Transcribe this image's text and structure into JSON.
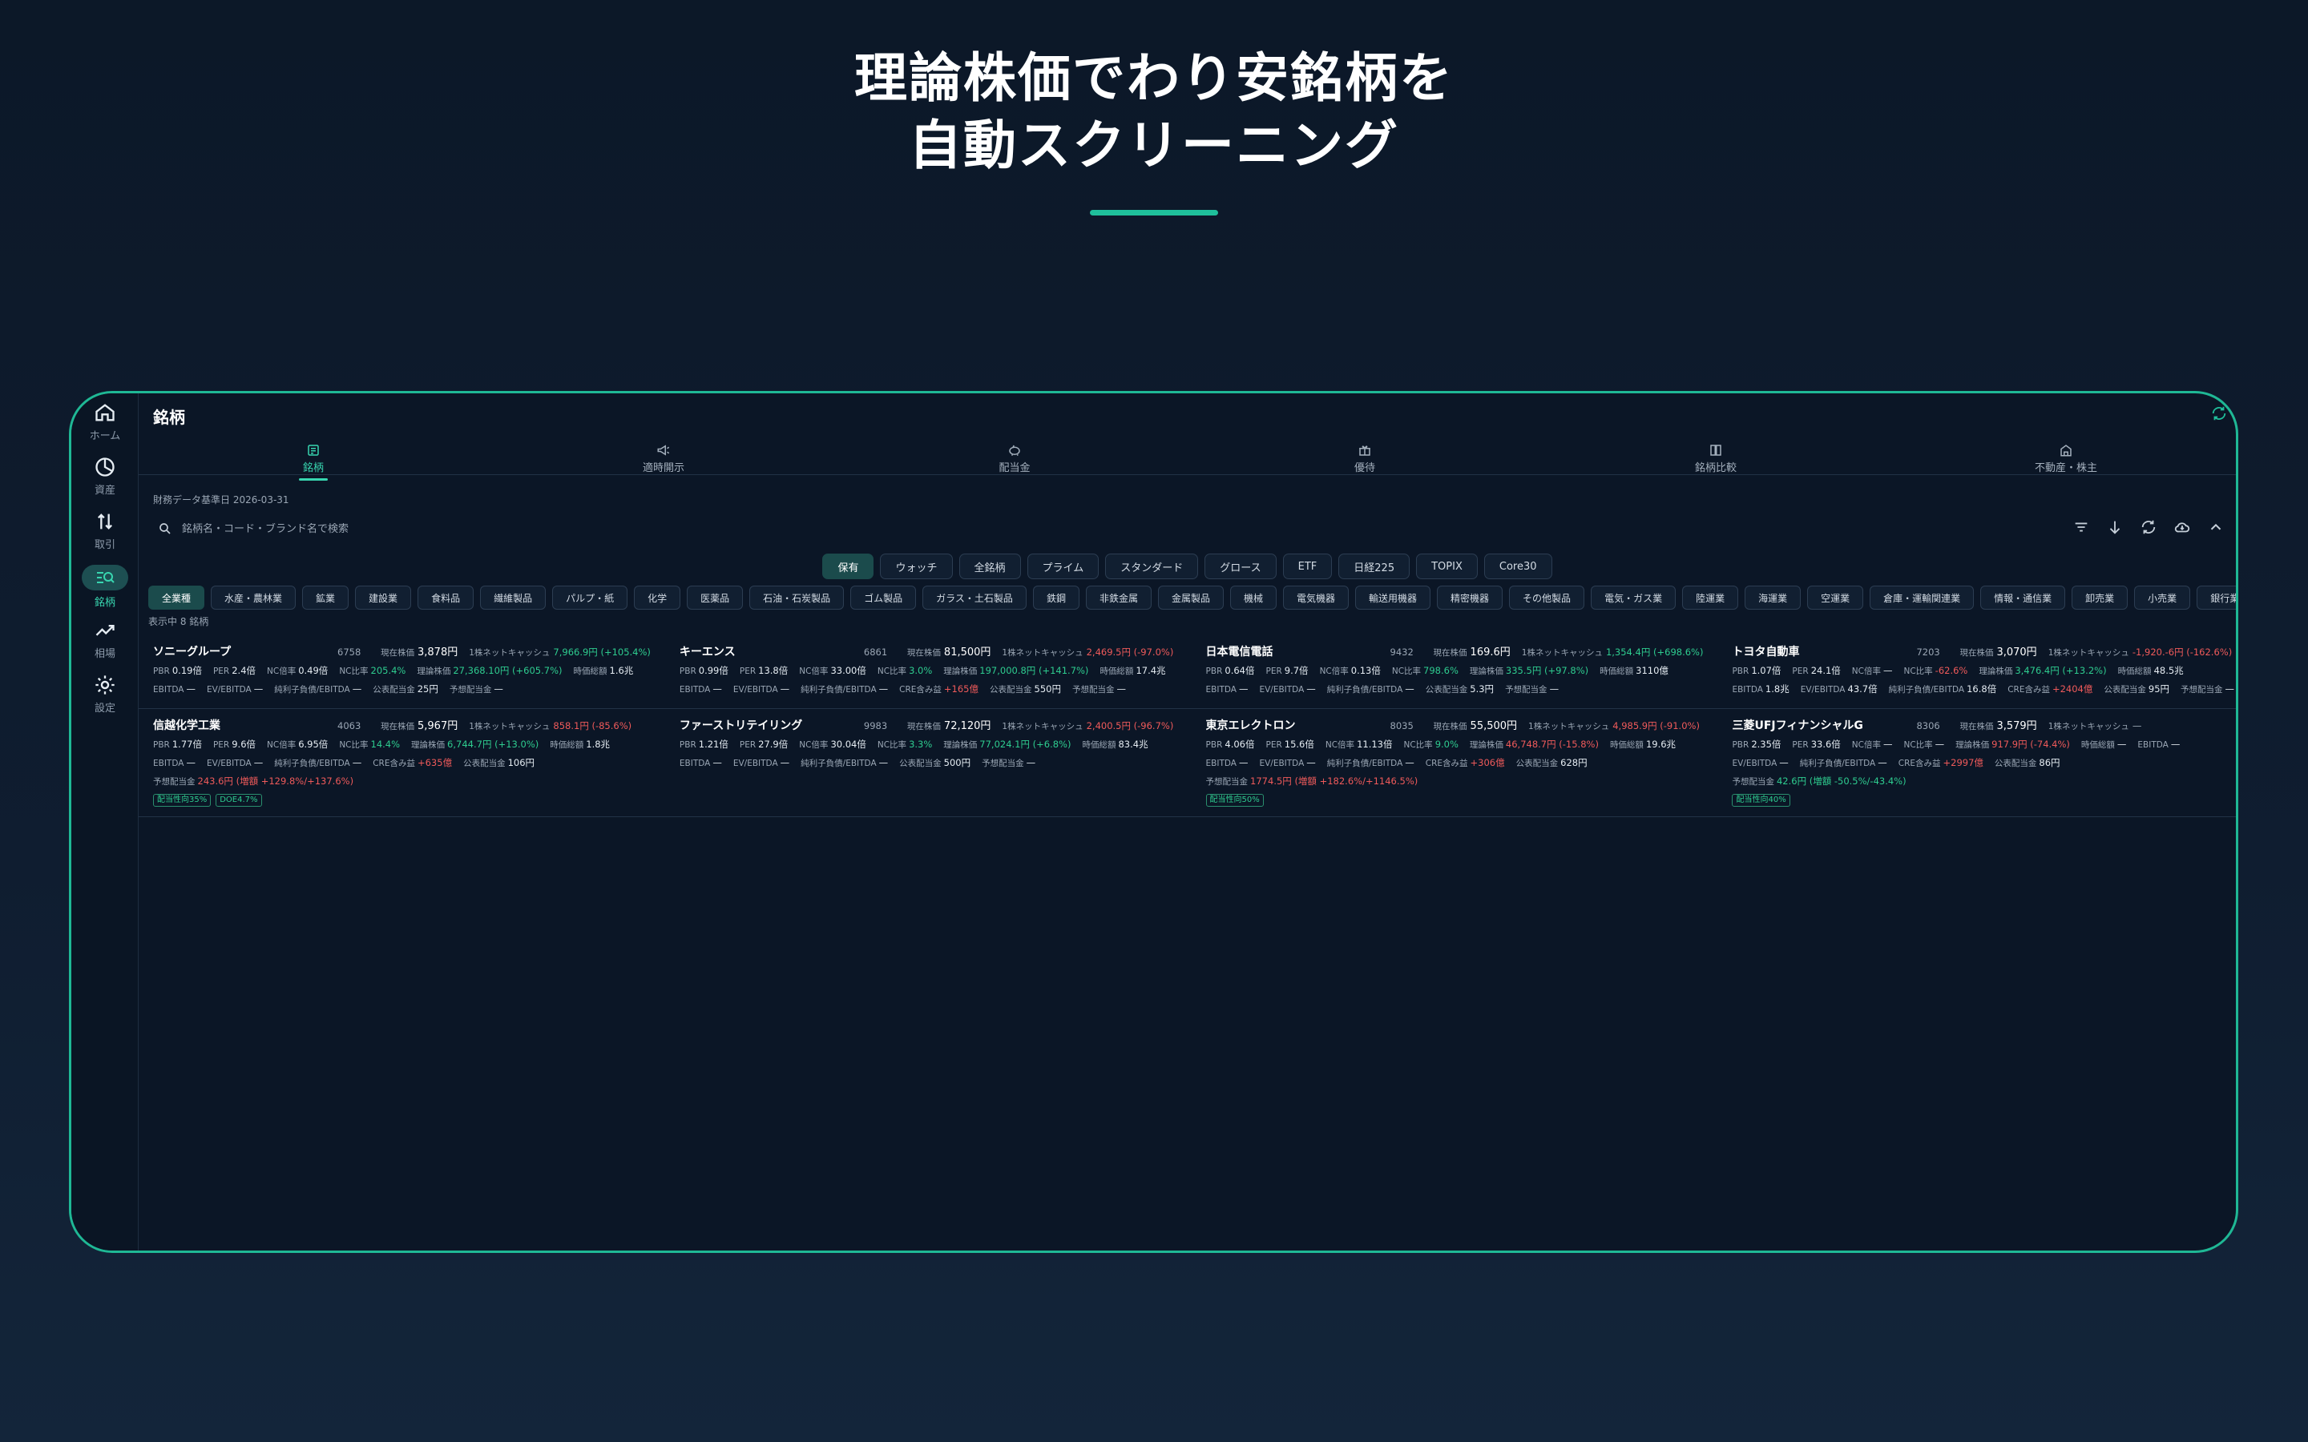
{
  "hero": {
    "line1": "理論株価でわり安銘柄を",
    "line2": "自動スクリーニング"
  },
  "sidebar": {
    "items": [
      {
        "label": "ホーム",
        "icon": "home-icon"
      },
      {
        "label": "資産",
        "icon": "pie-icon"
      },
      {
        "label": "取引",
        "icon": "swap-icon"
      },
      {
        "label": "銘柄",
        "icon": "screener-icon"
      },
      {
        "label": "相場",
        "icon": "trend-icon"
      },
      {
        "label": "設定",
        "icon": "gear-icon"
      }
    ]
  },
  "page": {
    "title": "銘柄",
    "base_date": "財務データ基準日 2026-03-31",
    "search_placeholder": "銘柄名・コード・ブランド名で検索",
    "count": "表示中 8 銘柄"
  },
  "tabs": [
    {
      "label": "銘柄"
    },
    {
      "label": "適時開示"
    },
    {
      "label": "配当金"
    },
    {
      "label": "優待"
    },
    {
      "label": "銘柄比較"
    },
    {
      "label": "不動産・株主"
    }
  ],
  "filters": [
    "保有",
    "ウォッチ",
    "全銘柄",
    "プライム",
    "スタンダード",
    "グロース",
    "ETF",
    "日経225",
    "TOPIX",
    "Core30"
  ],
  "sectors": [
    "全業種",
    "水産・農林業",
    "鉱業",
    "建設業",
    "食料品",
    "繊維製品",
    "パルプ・紙",
    "化学",
    "医薬品",
    "石油・石炭製品",
    "ゴム製品",
    "ガラス・土石製品",
    "鉄鋼",
    "非鉄金属",
    "金属製品",
    "機械",
    "電気機器",
    "輸送用機器",
    "精密機器",
    "その他製品",
    "電気・ガス業",
    "陸運業",
    "海運業",
    "空運業",
    "倉庫・運輸関連業",
    "情報・通信業",
    "卸売業",
    "小売業",
    "銀行業"
  ],
  "labels": {
    "price": "現在株価",
    "netcash": "1株ネットキャッシュ"
  },
  "stocks": [
    {
      "name": "ソニーグループ",
      "code": "6758",
      "price": "3,878円",
      "netcash": "7,966.9円 (+105.4%)",
      "netcash_class": "pos",
      "row2": [
        [
          "PBR",
          "0.19倍",
          ""
        ],
        [
          "PER",
          "2.4倍",
          ""
        ],
        [
          "NC倍率",
          "0.49倍",
          ""
        ],
        [
          "NC比率",
          "205.4%",
          "pos"
        ],
        [
          "理論株価",
          "27,368.10円 (+605.7%)",
          "pos"
        ],
        [
          "時価総額",
          "1.6兆",
          ""
        ]
      ],
      "row3": [
        [
          "EBITDA",
          "—",
          ""
        ],
        [
          "EV/EBITDA",
          "—",
          ""
        ],
        [
          "純利子負債/EBITDA",
          "—",
          ""
        ],
        [
          "公表配当金",
          "25円",
          ""
        ],
        [
          "予想配当金",
          "—",
          ""
        ]
      ]
    },
    {
      "name": "キーエンス",
      "code": "6861",
      "price": "81,500円",
      "netcash": "2,469.5円 (-97.0%)",
      "netcash_class": "neg",
      "row2": [
        [
          "PBR",
          "0.99倍",
          ""
        ],
        [
          "PER",
          "13.8倍",
          ""
        ],
        [
          "NC倍率",
          "33.00倍",
          ""
        ],
        [
          "NC比率",
          "3.0%",
          "pos"
        ],
        [
          "理論株価",
          "197,000.8円 (+141.7%)",
          "pos"
        ],
        [
          "時価総額",
          "17.4兆",
          ""
        ]
      ],
      "row3": [
        [
          "EBITDA",
          "—",
          ""
        ],
        [
          "EV/EBITDA",
          "—",
          ""
        ],
        [
          "純利子負債/EBITDA",
          "—",
          ""
        ],
        [
          "CRE含み益",
          "+165億",
          "neg"
        ],
        [
          "公表配当金",
          "550円",
          ""
        ],
        [
          "予想配当金",
          "—",
          ""
        ]
      ]
    },
    {
      "name": "日本電信電話",
      "code": "9432",
      "price": "169.6円",
      "netcash": "1,354.4円 (+698.6%)",
      "netcash_class": "pos",
      "row2": [
        [
          "PBR",
          "0.64倍",
          ""
        ],
        [
          "PER",
          "9.7倍",
          ""
        ],
        [
          "NC倍率",
          "0.13倍",
          ""
        ],
        [
          "NC比率",
          "798.6%",
          "pos"
        ],
        [
          "理論株価",
          "335.5円 (+97.8%)",
          "pos"
        ],
        [
          "時価総額",
          "3110億",
          ""
        ]
      ],
      "row3": [
        [
          "EBITDA",
          "—",
          ""
        ],
        [
          "EV/EBITDA",
          "—",
          ""
        ],
        [
          "純利子負債/EBITDA",
          "—",
          ""
        ],
        [
          "公表配当金",
          "5.3円",
          ""
        ],
        [
          "予想配当金",
          "—",
          ""
        ]
      ]
    },
    {
      "name": "トヨタ自動車",
      "code": "7203",
      "price": "3,070円",
      "netcash": "-1,920.-6円 (-162.6%)",
      "netcash_class": "neg",
      "row2": [
        [
          "PBR",
          "1.07倍",
          ""
        ],
        [
          "PER",
          "24.1倍",
          ""
        ],
        [
          "NC倍率",
          "—",
          ""
        ],
        [
          "NC比率",
          "-62.6%",
          "neg"
        ],
        [
          "理論株価",
          "3,476.4円 (+13.2%)",
          "pos"
        ],
        [
          "時価総額",
          "48.5兆",
          ""
        ]
      ],
      "row3": [
        [
          "EBITDA",
          "1.8兆",
          ""
        ],
        [
          "EV/EBITDA",
          "43.7倍",
          ""
        ],
        [
          "純利子負債/EBITDA",
          "16.8倍",
          ""
        ],
        [
          "CRE含み益",
          "+2404億",
          "neg"
        ],
        [
          "公表配当金",
          "95円",
          ""
        ],
        [
          "予想配当金",
          "—",
          ""
        ]
      ]
    },
    {
      "name": "信越化学工業",
      "code": "4063",
      "price": "5,967円",
      "netcash": "858.1円 (-85.6%)",
      "netcash_class": "neg",
      "row2": [
        [
          "PBR",
          "1.77倍",
          ""
        ],
        [
          "PER",
          "9.6倍",
          ""
        ],
        [
          "NC倍率",
          "6.95倍",
          ""
        ],
        [
          "NC比率",
          "14.4%",
          "pos"
        ],
        [
          "理論株価",
          "6,744.7円 (+13.0%)",
          "pos"
        ],
        [
          "時価総額",
          "1.8兆",
          ""
        ]
      ],
      "row3": [
        [
          "EBITDA",
          "—",
          ""
        ],
        [
          "EV/EBITDA",
          "—",
          ""
        ],
        [
          "純利子負債/EBITDA",
          "—",
          ""
        ],
        [
          "CRE含み益",
          "+635億",
          "neg"
        ],
        [
          "公表配当金",
          "106円",
          ""
        ]
      ],
      "row4": {
        "label": "予想配当金",
        "value": "243.6円 (増額 +129.8%/+137.6%)",
        "class": "neg"
      },
      "tags": [
        "配当性向35%",
        "DOE4.7%"
      ]
    },
    {
      "name": "ファーストリテイリング",
      "code": "9983",
      "price": "72,120円",
      "netcash": "2,400.5円 (-96.7%)",
      "netcash_class": "neg",
      "row2": [
        [
          "PBR",
          "1.21倍",
          ""
        ],
        [
          "PER",
          "27.9倍",
          ""
        ],
        [
          "NC倍率",
          "30.04倍",
          ""
        ],
        [
          "NC比率",
          "3.3%",
          "pos"
        ],
        [
          "理論株価",
          "77,024.1円 (+6.8%)",
          "pos"
        ],
        [
          "時価総額",
          "83.4兆",
          ""
        ]
      ],
      "row3": [
        [
          "EBITDA",
          "—",
          ""
        ],
        [
          "EV/EBITDA",
          "—",
          ""
        ],
        [
          "純利子負債/EBITDA",
          "—",
          ""
        ],
        [
          "公表配当金",
          "500円",
          ""
        ],
        [
          "予想配当金",
          "—",
          ""
        ]
      ]
    },
    {
      "name": "東京エレクトロン",
      "code": "8035",
      "price": "55,500円",
      "netcash": "4,985.9円 (-91.0%)",
      "netcash_class": "neg",
      "row2": [
        [
          "PBR",
          "4.06倍",
          ""
        ],
        [
          "PER",
          "15.6倍",
          ""
        ],
        [
          "NC倍率",
          "11.13倍",
          ""
        ],
        [
          "NC比率",
          "9.0%",
          "pos"
        ],
        [
          "理論株価",
          "46,748.7円 (-15.8%)",
          "neg"
        ],
        [
          "時価総額",
          "19.6兆",
          ""
        ]
      ],
      "row3": [
        [
          "EBITDA",
          "—",
          ""
        ],
        [
          "EV/EBITDA",
          "—",
          ""
        ],
        [
          "純利子負債/EBITDA",
          "—",
          ""
        ],
        [
          "CRE含み益",
          "+306億",
          "neg"
        ],
        [
          "公表配当金",
          "628円",
          ""
        ]
      ],
      "row4": {
        "label": "予想配当金",
        "value": "1774.5円 (増額 +182.6%/+1146.5%)",
        "class": "neg"
      },
      "tags": [
        "配当性向50%"
      ]
    },
    {
      "name": "三菱UFJフィナンシャルG",
      "code": "8306",
      "price": "3,579円",
      "netcash": "—",
      "netcash_class": "",
      "row2": [
        [
          "PBR",
          "2.35倍",
          ""
        ],
        [
          "PER",
          "33.6倍",
          ""
        ],
        [
          "NC倍率",
          "—",
          ""
        ],
        [
          "NC比率",
          "—",
          ""
        ],
        [
          "理論株価",
          "917.9円 (-74.4%)",
          "neg"
        ],
        [
          "時価総額",
          "—",
          ""
        ],
        [
          "EBITDA",
          "—",
          ""
        ]
      ],
      "row3": [
        [
          "EV/EBITDA",
          "—",
          ""
        ],
        [
          "純利子負債/EBITDA",
          "—",
          ""
        ],
        [
          "CRE含み益",
          "+2997億",
          "neg"
        ],
        [
          "公表配当金",
          "86円",
          ""
        ]
      ],
      "row4": {
        "label": "予想配当金",
        "value": "42.6円 (増額 -50.5%/-43.4%)",
        "class": "pos"
      },
      "tags": [
        "配当性向40%"
      ]
    }
  ]
}
